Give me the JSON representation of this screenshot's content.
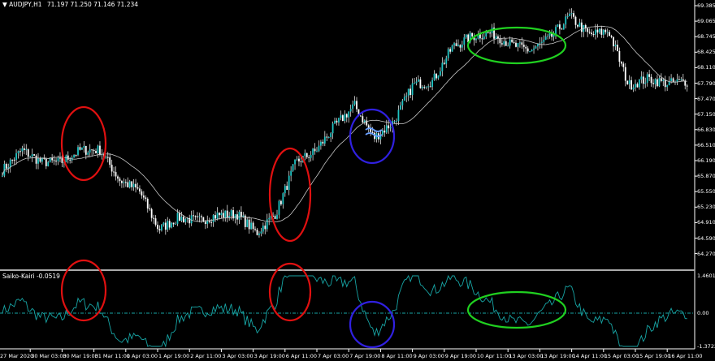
{
  "header": {
    "symbol_label": "AUDJPY,H1",
    "ohlc": "71.197 71.250 71.146 71.234"
  },
  "indicator": {
    "label": "Saiko-Kairi -0.0519"
  },
  "price_axis": [
    "69.385",
    "69.065",
    "68.745",
    "68.425",
    "68.110",
    "67.790",
    "67.470",
    "67.150",
    "66.830",
    "66.510",
    "66.190",
    "65.870",
    "65.550",
    "65.230",
    "64.910",
    "64.590",
    "64.270"
  ],
  "indicator_axis": {
    "max": "1.4601",
    "zero": "0.00",
    "min": "-1.3722"
  },
  "time_axis": [
    "27 Mar 2020",
    "30 Mar 03:00",
    "30 Mar 19:00",
    "31 Mar 11:00",
    "1 Apr 03:00",
    "1 Apr 19:00",
    "2 Apr 11:00",
    "3 Apr 03:00",
    "3 Apr 19:00",
    "6 Apr 11:00",
    "7 Apr 03:00",
    "7 Apr 19:00",
    "8 Apr 11:00",
    "9 Apr 03:00",
    "9 Apr 19:00",
    "10 Apr 11:00",
    "13 Apr 03:00",
    "13 Apr 19:00",
    "14 Apr 11:00",
    "15 Apr 03:00",
    "15 Apr 19:00",
    "16 Apr 11:00"
  ],
  "chart_data": {
    "type": "candlestick",
    "price_range": [
      64.27,
      69.385
    ],
    "indicator_range": [
      -1.3722,
      1.4601
    ],
    "approx_close_path": [
      65.99,
      66.41,
      66.16,
      66.16,
      66.41,
      66.41,
      65.79,
      65.57,
      64.77,
      65.02,
      64.95,
      65.07,
      65.09,
      64.7,
      65.12,
      66.16,
      66.38,
      66.91,
      67.33,
      66.66,
      66.99,
      67.76,
      67.83,
      68.53,
      68.75,
      68.83,
      68.58,
      68.46,
      68.72,
      69.17,
      68.78,
      68.87,
      67.75,
      67.88,
      67.78,
      67.83
    ],
    "colors": {
      "bull": "#1fc4c4",
      "bear": "#ffffff",
      "ma": "#c8c8c8",
      "indicator": "#17a5a5",
      "annotation_red": "#e01010",
      "annotation_blue": "#3020e0",
      "annotation_green": "#20d020"
    }
  }
}
